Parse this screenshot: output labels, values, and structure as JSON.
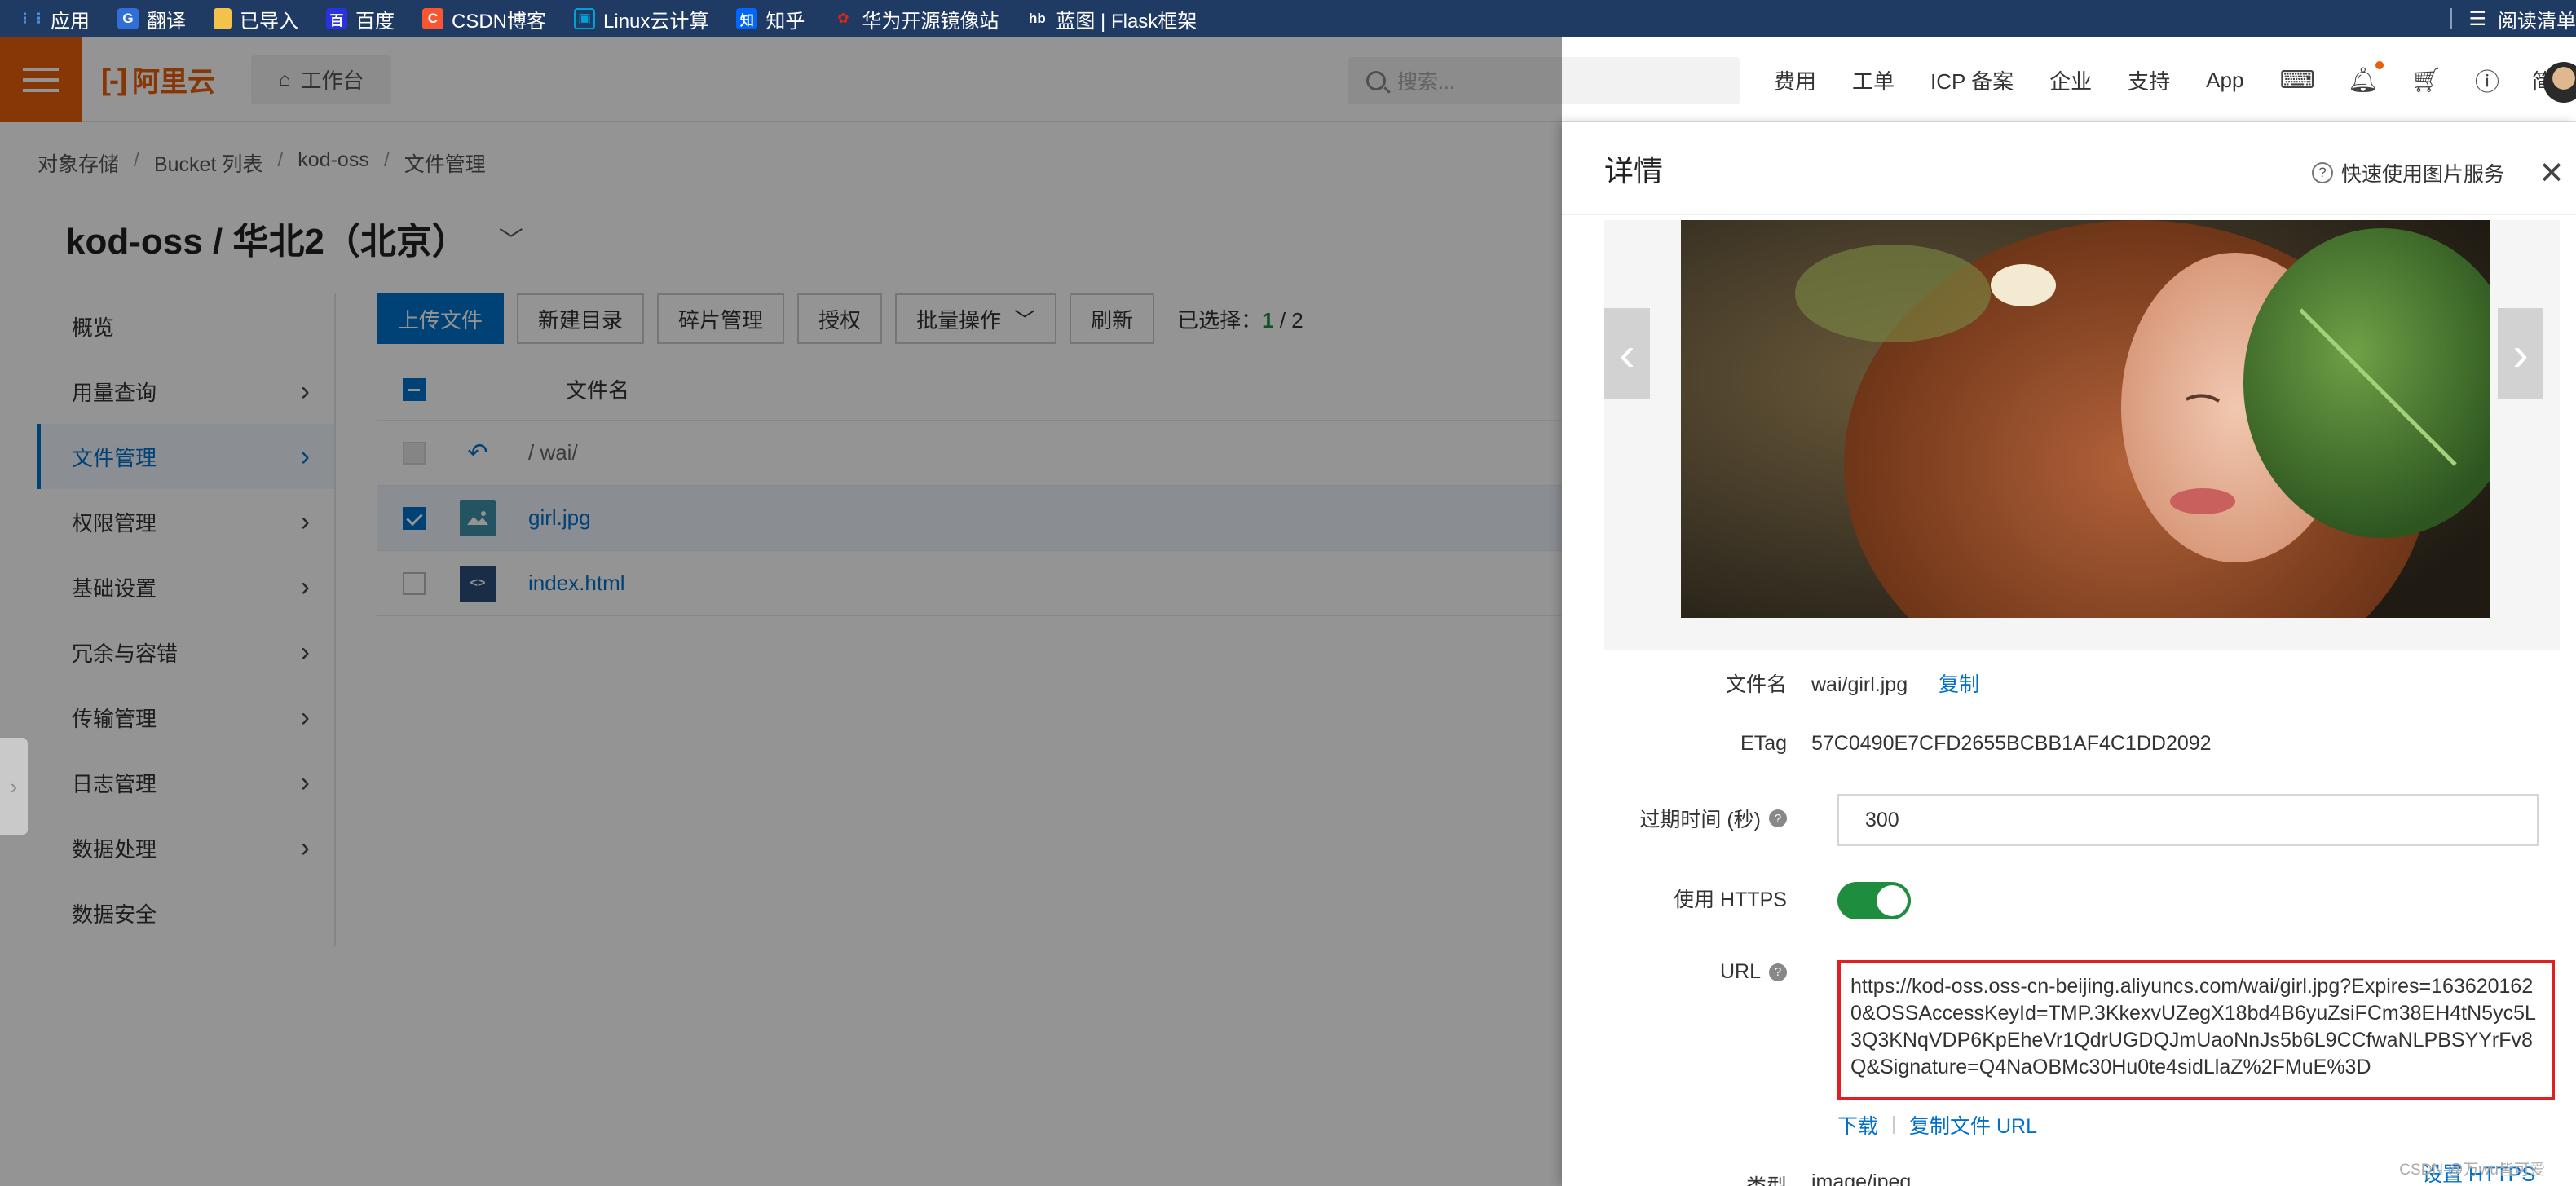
{
  "bookmarks": {
    "items": [
      {
        "label": "应用",
        "icon": "apps-grid-icon",
        "color": "#4a90e2"
      },
      {
        "label": "翻译",
        "icon": "translate-icon",
        "color": "#2f6fd6"
      },
      {
        "label": "已导入",
        "icon": "folder-icon",
        "color": "#f3c24b"
      },
      {
        "label": "百度",
        "icon": "baidu-icon",
        "color": "#2932e1"
      },
      {
        "label": "CSDN博客",
        "icon": "csdn-icon",
        "color": "#fc5531"
      },
      {
        "label": "Linux云计算",
        "icon": "bilibili-icon",
        "color": "#00a1d6"
      },
      {
        "label": "知乎",
        "icon": "zhihu-icon",
        "color": "#0066ff"
      },
      {
        "label": "华为开源镜像站",
        "icon": "huawei-icon",
        "color": "#e2231a"
      },
      {
        "label": "蓝图 | Flask框架",
        "icon": "blueprint-icon",
        "color": "#ffffff"
      }
    ],
    "reading_list": "阅读清单"
  },
  "topnav": {
    "logo": "阿里云",
    "workbench": "工作台",
    "search_placeholder": "搜索...",
    "links": [
      "费用",
      "工单",
      "ICP 备案",
      "企业",
      "支持",
      "App"
    ],
    "lang": "简体"
  },
  "breadcrumb": [
    "对象存储",
    "Bucket 列表",
    "kod-oss",
    "文件管理"
  ],
  "bucket_title": "kod-oss / 华北2（北京）",
  "sidenav": [
    {
      "label": "概览",
      "has_arrow": false,
      "active": false
    },
    {
      "label": "用量查询",
      "has_arrow": true,
      "active": false
    },
    {
      "label": "文件管理",
      "has_arrow": true,
      "active": true
    },
    {
      "label": "权限管理",
      "has_arrow": true,
      "active": false
    },
    {
      "label": "基础设置",
      "has_arrow": true,
      "active": false
    },
    {
      "label": "冗余与容错",
      "has_arrow": true,
      "active": false
    },
    {
      "label": "传输管理",
      "has_arrow": true,
      "active": false
    },
    {
      "label": "日志管理",
      "has_arrow": true,
      "active": false
    },
    {
      "label": "数据处理",
      "has_arrow": true,
      "active": false
    },
    {
      "label": "数据安全",
      "has_arrow": false,
      "active": false
    }
  ],
  "toolbar": {
    "upload": "上传文件",
    "new_dir": "新建目录",
    "fragments": "碎片管理",
    "authorize": "授权",
    "batch": "批量操作",
    "refresh": "刷新",
    "selected_label": "已选择：",
    "selected_count": "1",
    "total_count": "/ 2"
  },
  "file_table": {
    "header": "文件名",
    "up_dir": "/ wai/",
    "files": [
      {
        "name": "girl.jpg",
        "type": "image",
        "checked": true
      },
      {
        "name": "index.html",
        "type": "html",
        "checked": false
      }
    ]
  },
  "detail": {
    "title": "详情",
    "quick_service": "快速使用图片服务",
    "filename_label": "文件名",
    "filename": "wai/girl.jpg",
    "copy": "复制",
    "etag_label": "ETag",
    "etag": "57C0490E7CFD2655BCBB1AF4C1DD2092",
    "expire_label": "过期时间 (秒)",
    "expire_value": "300",
    "https_label": "使用 HTTPS",
    "https_on": true,
    "url_label": "URL",
    "url": "https://kod-oss.oss-cn-beijing.aliyuncs.com/wai/girl.jpg?Expires=1636201620&OSSAccessKeyId=TMP.3KkexvUZegX18bd4B6yuZsiFCm38EH4tN5yc5L3Q3KNqVDP6KpEheVr1QdrUGDQJmUaoNnJs5b6L9CCfwaNLPBSYYrFv8Q&Signature=Q4NaOBMc30Hu0te4sidLlaZ%2FMuE%3D",
    "download": "下载",
    "copy_url": "复制文件 URL",
    "type_label": "类型",
    "type_value": "image/jpeg",
    "config_https": "设置 HTTPS",
    "watermark": "CSDN @万wu皆可爱"
  },
  "colors": {
    "brand": "#e8600a",
    "primary": "#0070cc",
    "success": "#1e8e3e",
    "highlight": "#e02020"
  }
}
